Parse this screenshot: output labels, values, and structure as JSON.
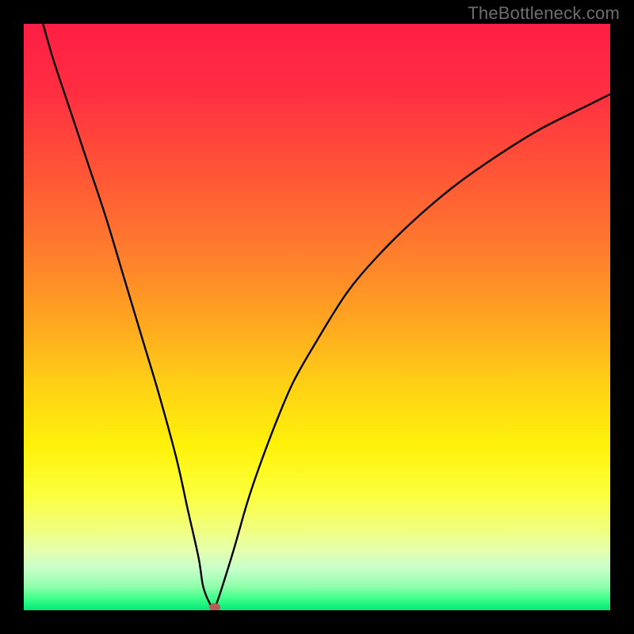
{
  "watermark": "TheBottleneck.com",
  "gradient_stops": [
    {
      "pct": 0,
      "color": "#ff1e45"
    },
    {
      "pct": 12,
      "color": "#ff2f41"
    },
    {
      "pct": 25,
      "color": "#ff5437"
    },
    {
      "pct": 38,
      "color": "#ff7a2e"
    },
    {
      "pct": 50,
      "color": "#ffa321"
    },
    {
      "pct": 62,
      "color": "#ffd215"
    },
    {
      "pct": 72,
      "color": "#fff20a"
    },
    {
      "pct": 80,
      "color": "#fcff3a"
    },
    {
      "pct": 86,
      "color": "#f2ff7d"
    },
    {
      "pct": 90,
      "color": "#e3ffb0"
    },
    {
      "pct": 93,
      "color": "#c6ffc9"
    },
    {
      "pct": 96,
      "color": "#8effab"
    },
    {
      "pct": 98,
      "color": "#3fff8a"
    },
    {
      "pct": 100,
      "color": "#00e977"
    }
  ],
  "chart_data": {
    "type": "line",
    "xlim": [
      0,
      100
    ],
    "ylim": [
      0,
      100
    ],
    "xlabel": "",
    "ylabel": "",
    "title": "",
    "series": [
      {
        "name": "bottleneck-curve",
        "x": [
          3,
          5,
          8,
          11,
          14,
          17,
          20,
          23,
          26,
          28,
          29.8,
          30.6,
          31.8,
          32.5,
          33,
          34,
          36,
          38,
          40,
          43,
          46,
          50,
          55,
          60,
          66,
          73,
          80,
          88,
          96,
          100
        ],
        "y": [
          101,
          94,
          85,
          76,
          67,
          57,
          47,
          37,
          26,
          17,
          9,
          4,
          1,
          0.5,
          1.5,
          4.5,
          11,
          18,
          24,
          32,
          39,
          46,
          54,
          60,
          66,
          72,
          77,
          82,
          86,
          88
        ]
      }
    ],
    "marker": {
      "x": 32.5,
      "y": 0.5
    },
    "legend": false,
    "background": "vertical-gradient"
  }
}
